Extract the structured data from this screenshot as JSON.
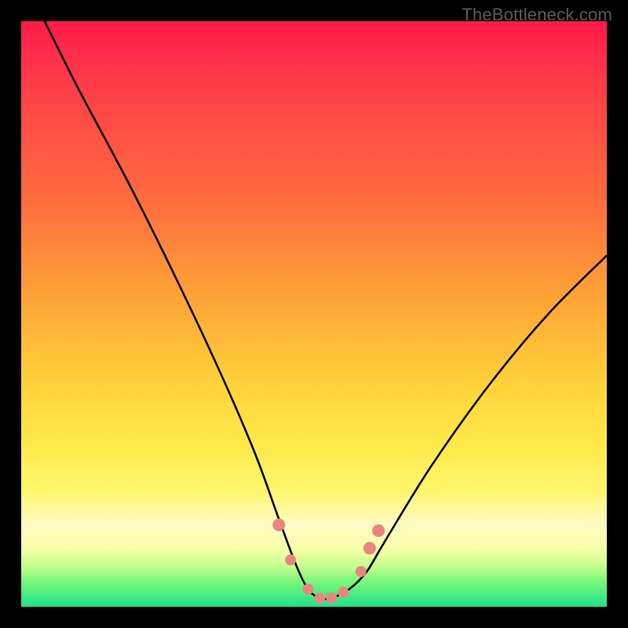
{
  "watermark": "TheBottleneck.com",
  "chart_data": {
    "type": "line",
    "title": "",
    "xlabel": "",
    "ylabel": "",
    "xlim": [
      0,
      100
    ],
    "ylim": [
      0,
      100
    ],
    "series": [
      {
        "name": "bottleneck-curve",
        "x": [
          4,
          10,
          18,
          26,
          34,
          40,
          44,
          47,
          49,
          51,
          53,
          56,
          59,
          62,
          70,
          80,
          90,
          100
        ],
        "y": [
          100,
          88,
          73,
          57,
          40,
          26,
          15,
          7,
          3,
          1.5,
          1.5,
          3,
          6,
          11,
          24,
          38,
          50,
          60
        ]
      }
    ],
    "markers": {
      "name": "highlight-points",
      "x": [
        44,
        46,
        49,
        51,
        53,
        55,
        58,
        59.5,
        61
      ],
      "y": [
        14,
        8,
        3,
        1.5,
        1.5,
        2.5,
        6,
        10,
        13
      ],
      "r": [
        8,
        7,
        7,
        7,
        7,
        7,
        7,
        8,
        8
      ]
    },
    "gradient_stops": [
      {
        "pos": 0,
        "color": "#ff1a4b"
      },
      {
        "pos": 30,
        "color": "#ff6a3e"
      },
      {
        "pos": 62,
        "color": "#ffd23a"
      },
      {
        "pos": 86,
        "color": "#fffac4"
      },
      {
        "pos": 100,
        "color": "#1fe188"
      }
    ]
  }
}
